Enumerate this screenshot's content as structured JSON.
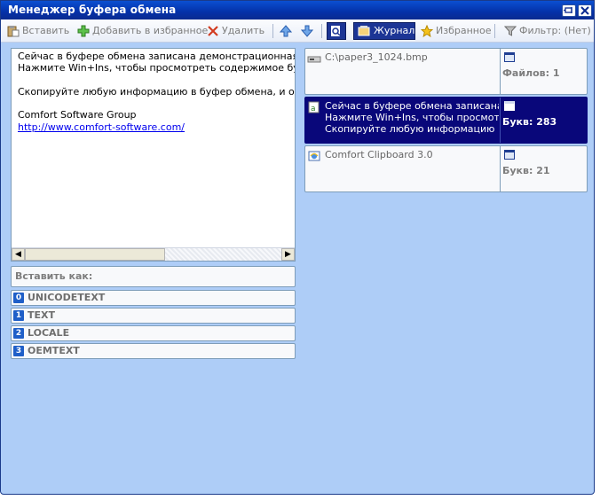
{
  "window": {
    "title": "Менеджер буфера обмена"
  },
  "toolbar": {
    "paste": "Вставить",
    "add_favorite": "Добавить в избранное",
    "delete": "Удалить",
    "journal": "Журнал",
    "favorites": "Избранное",
    "filter": "Фильтр: (Нет)"
  },
  "preview": {
    "lines": [
      "Сейчас в буфере обмена записана демонстрационная информация.",
      "Нажмите Win+Ins, чтобы просмотреть содержимое буфера обмена.",
      "",
      "Скопируйте любую информацию в буфер обмена, и она будет сохранена.",
      "",
      "Comfort Software Group"
    ],
    "link": "http://www.comfort-software.com/"
  },
  "paste_as": {
    "label": "Вставить как:",
    "formats": [
      {
        "num": "0",
        "name": "UNICODETEXT"
      },
      {
        "num": "1",
        "name": "TEXT"
      },
      {
        "num": "2",
        "name": "LOCALE"
      },
      {
        "num": "3",
        "name": "OEMTEXT"
      }
    ]
  },
  "history": [
    {
      "lines": [
        "C:\\paper3_1024.bmp"
      ],
      "stat": "Файлов: 1",
      "icon": "drive-icon"
    },
    {
      "lines": [
        "Сейчас в буфере обмена записана демонстрационная",
        "Нажмите Win+Ins, чтобы просмотреть содержимое",
        "",
        "Скопируйте любую информацию в буфер обмена"
      ],
      "stat": "Букв: 283",
      "icon": "text-document-icon"
    },
    {
      "lines": [
        "Comfort Clipboard 3.0"
      ],
      "stat": "Букв: 21",
      "icon": "browser-icon"
    }
  ],
  "colors": {
    "accent": "#09077a",
    "panel_bg": "#aecdf7",
    "title_bar": "#0431a8"
  }
}
